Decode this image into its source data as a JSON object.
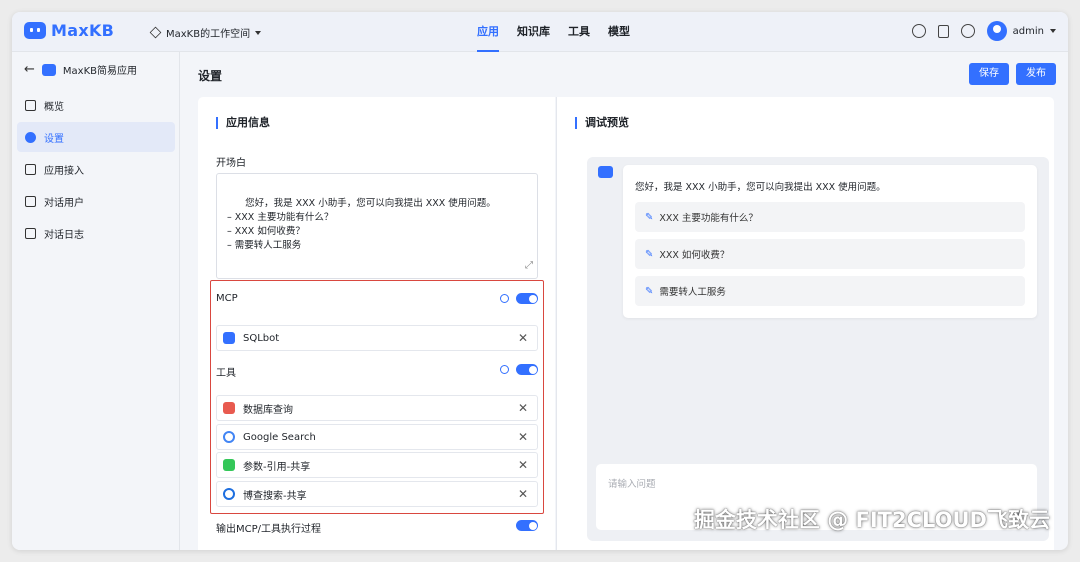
{
  "brand": {
    "name": "MaxKB"
  },
  "workspace": {
    "label": "MaxKB的工作空间"
  },
  "nav": [
    {
      "label": "应用",
      "active": true
    },
    {
      "label": "知识库",
      "active": false
    },
    {
      "label": "工具",
      "active": false
    },
    {
      "label": "模型",
      "active": false
    }
  ],
  "user": {
    "name": "admin"
  },
  "sidebar": {
    "app_name": "MaxKB简易应用",
    "items": [
      {
        "label": "概览",
        "icon": "grid-icon",
        "active": false
      },
      {
        "label": "设置",
        "icon": "gear-icon",
        "active": true
      },
      {
        "label": "应用接入",
        "icon": "cube-icon",
        "active": false
      },
      {
        "label": "对话用户",
        "icon": "user-icon",
        "active": false
      },
      {
        "label": "对话日志",
        "icon": "document-icon",
        "active": false
      }
    ]
  },
  "page": {
    "title": "设置",
    "save_label": "保存",
    "publish_label": "发布"
  },
  "app_info": {
    "title": "应用信息",
    "opening_label": "开场白",
    "opening_text": "您好，我是 XXX 小助手，您可以向我提出 XXX 使用问题。\n– XXX 主要功能有什么？\n– XXX 如何收费？\n– 需要转人工服务",
    "mcp_label": "MCP",
    "mcp_enabled": true,
    "mcp_items": [
      {
        "label": "SQLbot",
        "icon": "mcp-icon"
      }
    ],
    "tools_label": "工具",
    "tools_enabled": true,
    "tool_items": [
      {
        "label": "数据库查询",
        "icon": "pdf-icon"
      },
      {
        "label": "Google Search",
        "icon": "google-icon"
      },
      {
        "label": "参数-引用-共享",
        "icon": "bag-icon"
      },
      {
        "label": "博查搜索-共享",
        "icon": "bocha-icon"
      }
    ],
    "output_process_label": "输出MCP/工具执行过程",
    "output_process_enabled": true
  },
  "preview": {
    "title": "调试预览",
    "greeting": "您好，我是 XXX 小助手，您可以向我提出 XXX 使用问题。",
    "suggestions": [
      "XXX 主要功能有什么？",
      "XXX 如何收费？",
      "需要转人工服务"
    ],
    "input_placeholder": "请输入问题"
  },
  "watermark": "掘金技术社区 @ FIT2CLOUD飞致云",
  "colors": {
    "accent": "#3370ff",
    "highlight_border": "#d9473f"
  }
}
